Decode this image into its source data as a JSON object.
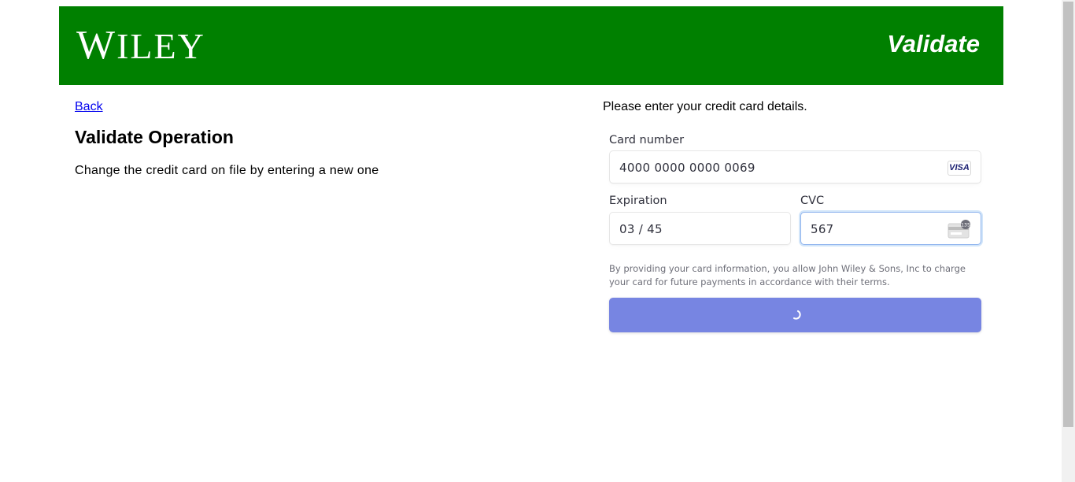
{
  "header": {
    "logo_text": "WILEY",
    "logo_first": "W",
    "logo_rest": "ILEY",
    "title": "Validate",
    "background_color": "#008000"
  },
  "nav": {
    "back_label": "Back"
  },
  "main": {
    "heading": "Validate Operation",
    "description": "Change the credit card on file by entering a new one"
  },
  "payment": {
    "intro": "Please enter your credit card details.",
    "card_number": {
      "label": "Card number",
      "value": "4000 0000 0000 0069",
      "brand": "VISA",
      "brand_icon": "visa-card-icon"
    },
    "expiration": {
      "label": "Expiration",
      "value": "03 / 45"
    },
    "cvc": {
      "label": "CVC",
      "value": "567",
      "icon": "cvc-card-icon",
      "icon_badge": "135"
    },
    "notice": "By providing your card information, you allow John Wiley & Sons, Inc to charge your card for future payments in accordance with their terms.",
    "submit": {
      "state": "loading",
      "icon": "spinner-icon",
      "color": "#7785e2"
    }
  }
}
